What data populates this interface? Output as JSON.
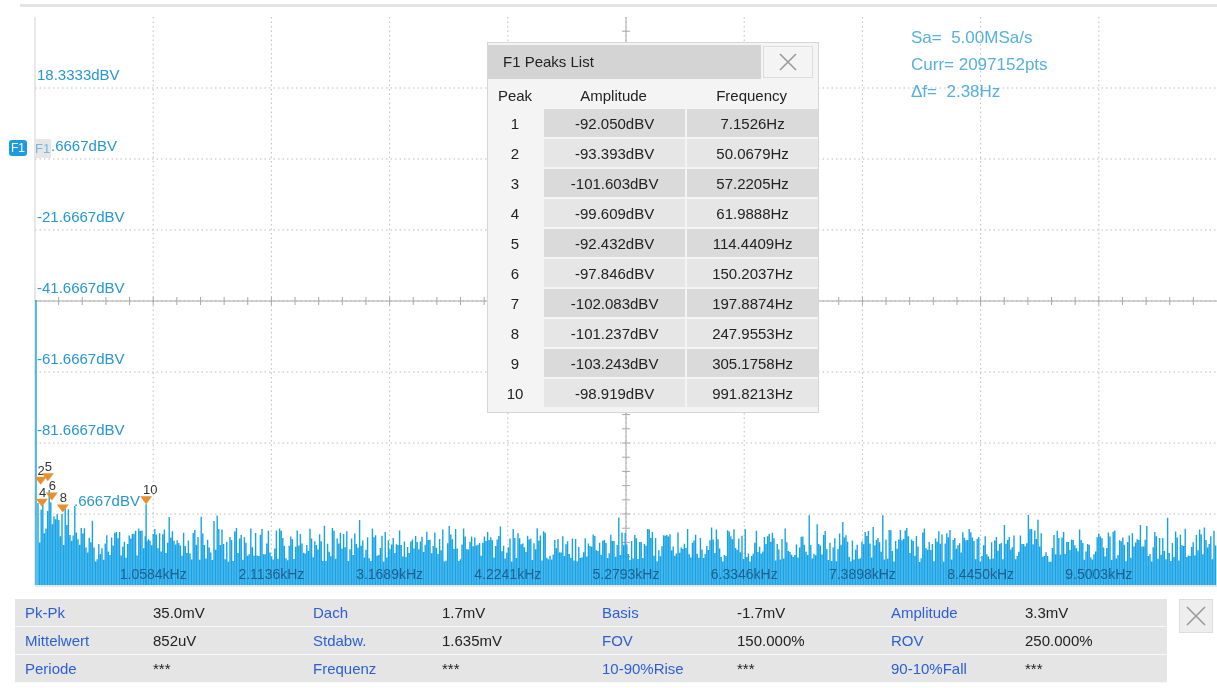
{
  "plot": {
    "info": [
      "Sa=  5.00MSa/s",
      "Curr= 2097152pts",
      "Δf=  2.38Hz"
    ],
    "channel_tag": "F1",
    "ref_tag": "F1",
    "y_labels": [
      "18.3333dBV",
      ".6667dBV",
      "-21.6667dBV",
      "-41.6667dBV",
      "-61.6667dBV",
      "-81.6667dBV",
      ".6667dBV"
    ],
    "x_labels": [
      "1.0584kHz",
      "2.1136kHz",
      "3.1689kHz",
      "4.2241kHz",
      "5.2793kHz",
      "6.3346kHz",
      "7.3898kHz",
      "8.4450kHz",
      "9.5003kHz"
    ]
  },
  "peaks_list": {
    "title": "F1 Peaks List",
    "columns": [
      "Peak",
      "Amplitude",
      "Frequency"
    ],
    "rows": [
      {
        "peak": "1",
        "amplitude": "-92.050dBV",
        "frequency": "7.1526Hz"
      },
      {
        "peak": "2",
        "amplitude": "-93.393dBV",
        "frequency": "50.0679Hz",
        "marker_label": "2"
      },
      {
        "peak": "3",
        "amplitude": "-101.603dBV",
        "frequency": "57.2205Hz"
      },
      {
        "peak": "4",
        "amplitude": "-99.609dBV",
        "frequency": "61.9888Hz",
        "marker_label": "4"
      },
      {
        "peak": "5",
        "amplitude": "-92.432dBV",
        "frequency": "114.4409Hz",
        "marker_label": "5"
      },
      {
        "peak": "6",
        "amplitude": "-97.846dBV",
        "frequency": "150.2037Hz",
        "marker_label": "6"
      },
      {
        "peak": "7",
        "amplitude": "-102.083dBV",
        "frequency": "197.8874Hz"
      },
      {
        "peak": "8",
        "amplitude": "-101.237dBV",
        "frequency": "247.9553Hz",
        "marker_label": "8"
      },
      {
        "peak": "9",
        "amplitude": "-103.243dBV",
        "frequency": "305.1758Hz"
      },
      {
        "peak": "10",
        "amplitude": "-98.919dBV",
        "frequency": "991.8213Hz",
        "marker_label": "10"
      }
    ]
  },
  "measurements": [
    [
      {
        "label": "Pk-Pk",
        "value": "35.0mV"
      },
      {
        "label": "Dach",
        "value": "1.7mV"
      },
      {
        "label": "Basis",
        "value": "-1.7mV"
      },
      {
        "label": "Amplitude",
        "value": "3.3mV"
      }
    ],
    [
      {
        "label": "Mittelwert",
        "value": "852uV"
      },
      {
        "label": "Stdabw.",
        "value": "1.635mV"
      },
      {
        "label": "FOV",
        "value": "150.000%"
      },
      {
        "label": "ROV",
        "value": "250.000%"
      }
    ],
    [
      {
        "label": "Periode",
        "value": "***"
      },
      {
        "label": "Frequenz",
        "value": "***"
      },
      {
        "label": "10-90%Rise",
        "value": "***"
      },
      {
        "label": "90-10%Fall",
        "value": "***"
      }
    ]
  ]
}
